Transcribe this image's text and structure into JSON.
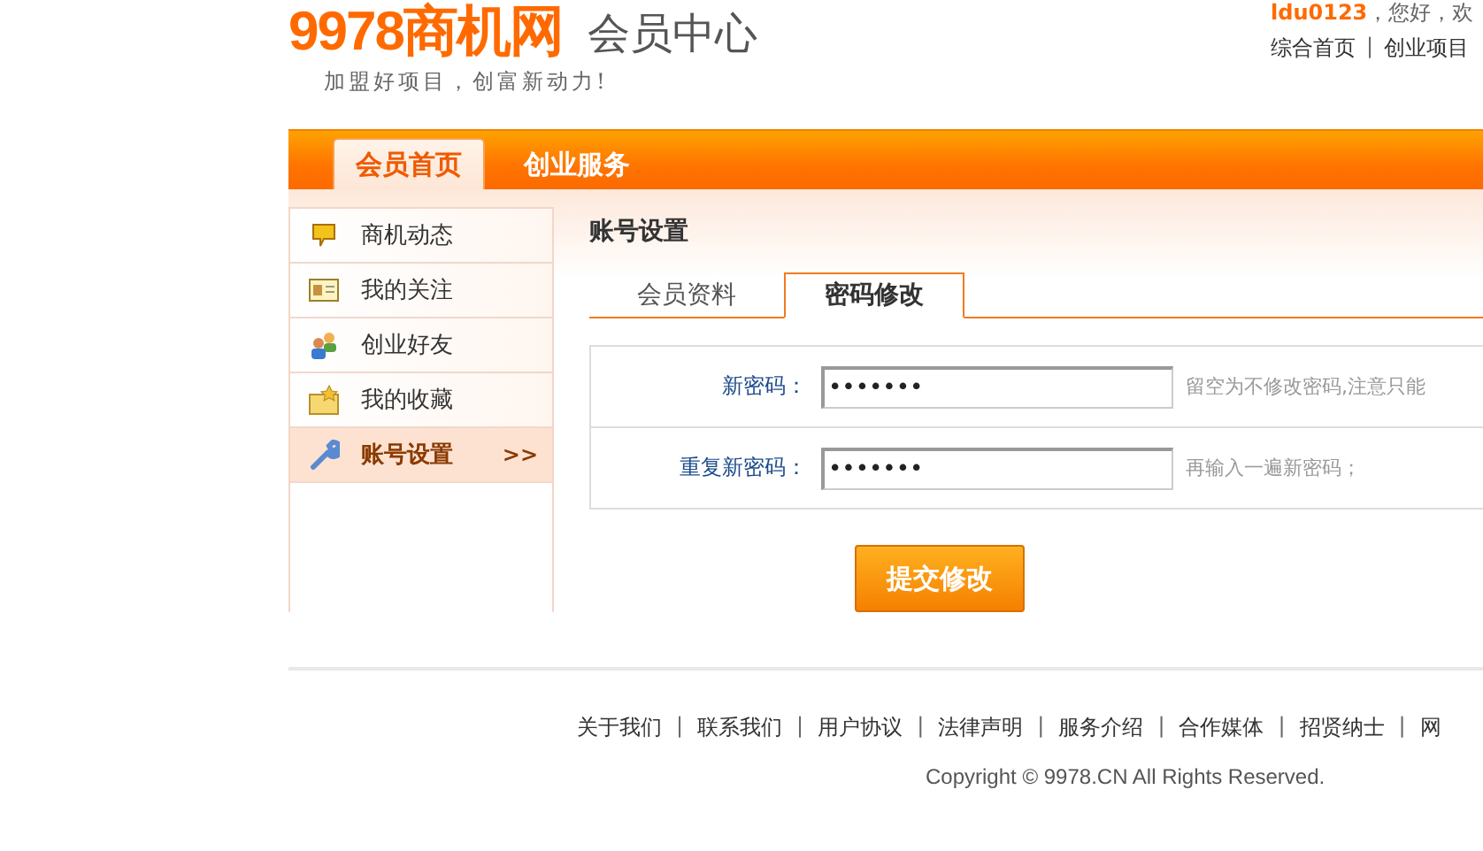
{
  "header": {
    "logo": "9978商机网",
    "section": "会员中心",
    "slogan": "加盟好项目，创富新动力!",
    "user": "ldu0123",
    "greeting": "，您好，欢",
    "links": [
      "综合首页",
      "创业项目"
    ],
    "separator": "|"
  },
  "nav": [
    {
      "label": "会员首页",
      "selected": true
    },
    {
      "label": "创业服务",
      "selected": false
    }
  ],
  "sidebar": [
    {
      "label": "商机动态",
      "kind": "message",
      "selected": false
    },
    {
      "label": "我的关注",
      "kind": "card",
      "selected": false
    },
    {
      "label": "创业好友",
      "kind": "people",
      "selected": false
    },
    {
      "label": "我的收藏",
      "kind": "folder",
      "selected": false
    },
    {
      "label": "账号设置",
      "kind": "wrench",
      "selected": true,
      "arrow": ">>"
    }
  ],
  "panel": {
    "title": "账号设置",
    "tabs": [
      {
        "label": "会员资料",
        "selected": false
      },
      {
        "label": "密码修改",
        "selected": true
      }
    ],
    "fields": [
      {
        "label": "新密码：",
        "value": "•••••••",
        "hint": "留空为不修改密码,注意只能"
      },
      {
        "label": "重复新密码：",
        "value": "•••••••",
        "hint": "再输入一遍新密码；"
      }
    ],
    "submit": "提交修改"
  },
  "footer": {
    "links": [
      "关于我们",
      "联系我们",
      "用户协议",
      "法律声明",
      "服务介绍",
      "合作媒体",
      "招贤纳士",
      "网"
    ],
    "separator": "|",
    "copyright": "Copyright © 9978.CN All Rights Reserved."
  }
}
